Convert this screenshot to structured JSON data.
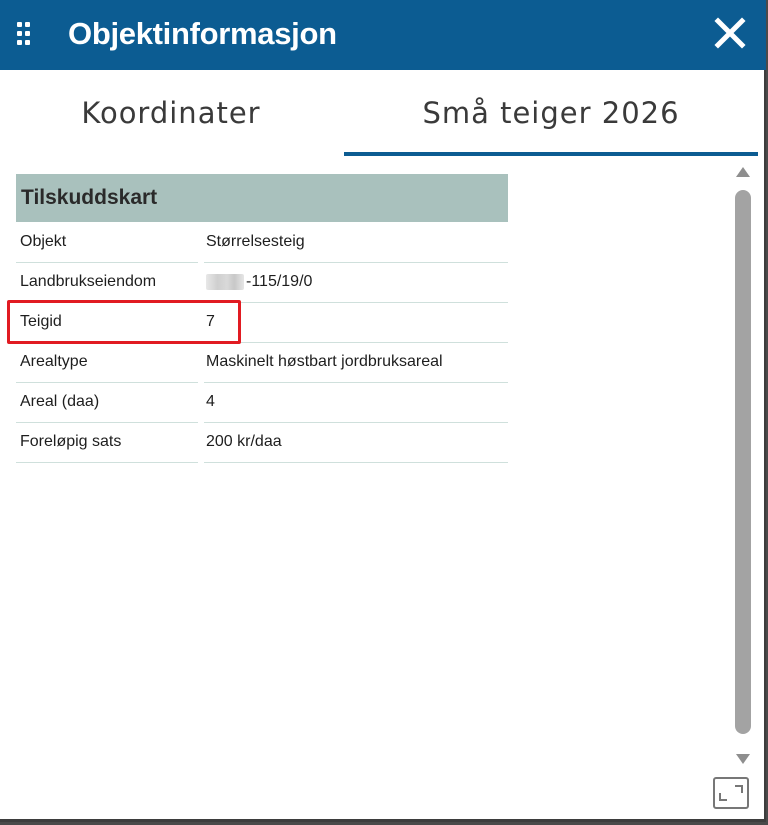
{
  "window": {
    "title": "Objektinformasjon",
    "icons": {
      "drag": "drag-handle-icon",
      "close": "close-icon"
    }
  },
  "tabs": [
    {
      "label": "Koordinater",
      "selected": false
    },
    {
      "label": "Små teiger 2026",
      "selected": true
    }
  ],
  "section": {
    "title": "Tilskuddskart",
    "rows": [
      {
        "key": "Objekt",
        "value": "Størrelsesteig"
      },
      {
        "key": "Landbrukseiendom",
        "value": "-115/19/0"
      },
      {
        "key": "Teigid",
        "value": "7"
      },
      {
        "key": "Arealtype",
        "value": "Maskinelt høstbart jordbruksareal"
      },
      {
        "key": "Areal (daa)",
        "value": "4"
      },
      {
        "key": "Foreløpig sats",
        "value": "200 kr/daa"
      }
    ]
  },
  "colors": {
    "titlebar": "#0c5c92",
    "section_header": "#a9c1bd",
    "highlight": "#e11b22",
    "tab_underline": "#0c5c92"
  }
}
